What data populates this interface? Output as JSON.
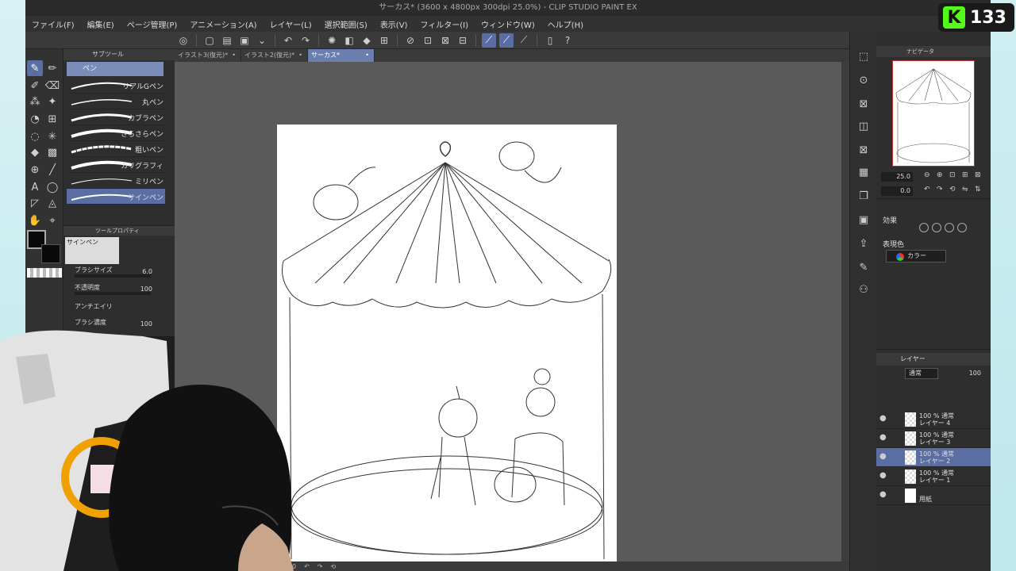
{
  "window": {
    "title": "サーカス* (3600 x 4800px 300dpi 25.0%)  - CLIP STUDIO PAINT EX"
  },
  "menu": [
    "ファイル(F)",
    "編集(E)",
    "ページ管理(P)",
    "アニメーション(A)",
    "レイヤー(L)",
    "選択範囲(S)",
    "表示(V)",
    "フィルター(I)",
    "ウィンドウ(W)",
    "ヘルプ(H)"
  ],
  "tabs": [
    {
      "label": "イラスト3(復元)*",
      "active": false
    },
    {
      "label": "イラスト2(復元)*",
      "active": false
    },
    {
      "label": "サーカス*",
      "active": true
    }
  ],
  "subtool": {
    "title": "サブツール",
    "group": "ペン",
    "brushes": [
      "リアルGペン",
      "丸ペン",
      "カブラペン",
      "さらさらペン",
      "粗いペン",
      "カリグラフィ",
      "ミリペン",
      "サインペン"
    ],
    "selected_index": 7
  },
  "toolprop": {
    "title": "ツールプロパティ",
    "brush_name": "サインペン",
    "brush_size_label": "ブラシサイズ",
    "brush_size_value": "6.0",
    "opacity_label": "不透明度",
    "opacity_value": "100",
    "antialias_label": "アンチエイリ",
    "density_label": "ブラシ濃度",
    "density_value": "100"
  },
  "navigator": {
    "title": "ナビゲータ",
    "zoom": "25.0",
    "rotation": "0.0"
  },
  "layer_property": {
    "effect_label": "効果",
    "color_label": "表現色",
    "color_value": "カラー"
  },
  "layers": {
    "title": "レイヤー",
    "blend": "通常",
    "opacity": "100",
    "items": [
      {
        "line1": "100 % 通常",
        "line2": "レイヤー 4",
        "selected": false
      },
      {
        "line1": "100 % 通常",
        "line2": "レイヤー 3",
        "selected": false
      },
      {
        "line1": "100 % 通常",
        "line2": "レイヤー 2",
        "selected": true
      },
      {
        "line1": "100 % 通常",
        "line2": "レイヤー 1",
        "selected": false
      },
      {
        "line1": "",
        "line2": "用紙",
        "selected": false
      }
    ]
  },
  "canvas_status": {
    "zoom_value": "0"
  },
  "stream": {
    "badge_letter": "K",
    "badge_number": "133"
  },
  "colors": {
    "accent": "#5a6ea3",
    "panel": "#2e2e2e",
    "paper": "#ffffff",
    "kick_green": "#53fc18"
  }
}
